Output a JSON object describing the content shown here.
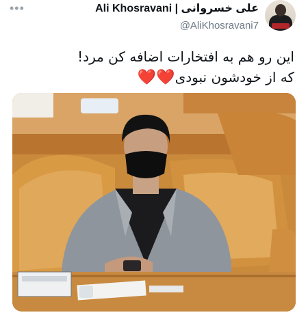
{
  "header": {
    "display_name": "علی خسروانی | Ali Khosravani",
    "handle": "@AliKhosravani7",
    "more_glyph": "•••"
  },
  "tweet": {
    "line1": "این رو هم به افتخارات اضافه کن مرد!",
    "line2": "که از خودشون نبودی",
    "hearts": "❤️❤️"
  },
  "media": {
    "nameplate_text": "علی خسروانی"
  },
  "colors": {
    "heart": "#e0245e",
    "handle": "#6d7a86",
    "seat": "#d9963a"
  },
  "icons": {
    "more": "more-horizontal-icon",
    "heart": "red-heart-emoji"
  }
}
